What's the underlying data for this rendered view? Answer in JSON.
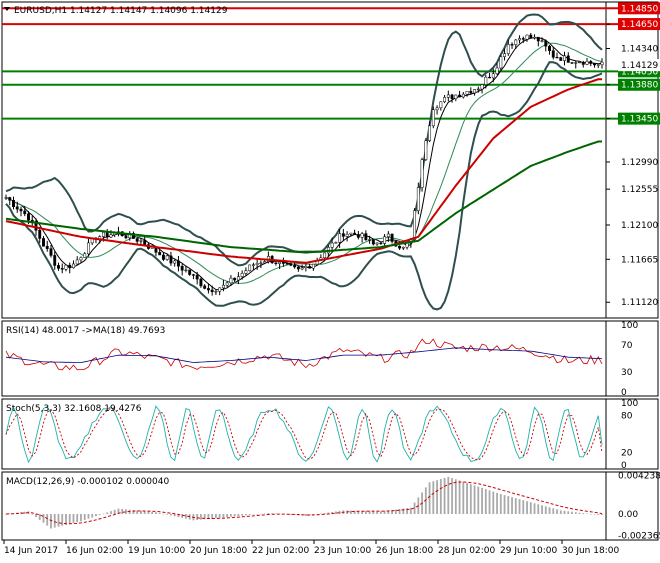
{
  "colors": {
    "candle": "#000000",
    "bb": "#2f4f4f",
    "ma_fast": "#000000",
    "ma_mid": "#2e8b57",
    "ma_red": "#cc0000",
    "ma_green": "#006400",
    "level_red": "#dd0000",
    "level_green": "#008000",
    "rsi_line": "#cc0000",
    "rsi_ma": "#000080",
    "stoch_main": "#20b2aa",
    "stoch_signal": "#cc0000",
    "macd_hist": "#a9a9a9",
    "macd_signal": "#cc0000"
  },
  "chart_data": [
    {
      "type": "candlestick",
      "title": "EURUSD,H1  1.14127 1.14147 1.14096 1.14129",
      "ylim": [
        1.1092,
        1.1493
      ],
      "y_ticks": [
        1.1112,
        1.11665,
        1.121,
        1.12555,
        1.129,
        1.1345,
        1.1388,
        1.1434,
        1.1465
      ],
      "y_tick_labels": [
        "1.11120",
        "1.11665",
        "1.12100",
        "1.12555",
        "1.12990",
        "1.13450",
        "1.13880",
        "1.14340",
        "1.14650"
      ],
      "levels": [
        {
          "value": 1.1485,
          "label": "1.14850",
          "color": "#dd0000"
        },
        {
          "value": 1.1465,
          "label": "1.14650",
          "color": "#dd0000"
        },
        {
          "value": 1.1405,
          "label": "1.14050",
          "color": "#008000"
        },
        {
          "value": 1.1388,
          "label": "1.13880",
          "color": "#008000"
        },
        {
          "value": 1.1345,
          "label": "1.13450",
          "color": "#008000"
        }
      ],
      "current_price": {
        "value": 1.14129,
        "label": "1.14129"
      },
      "price_keypoints": [
        [
          0,
          1.1245
        ],
        [
          6,
          1.122
        ],
        [
          10,
          1.1185
        ],
        [
          14,
          1.1155
        ],
        [
          18,
          1.116
        ],
        [
          24,
          1.1195
        ],
        [
          30,
          1.12
        ],
        [
          36,
          1.119
        ],
        [
          42,
          1.117
        ],
        [
          48,
          1.1152
        ],
        [
          54,
          1.1128
        ],
        [
          58,
          1.1132
        ],
        [
          62,
          1.1145
        ],
        [
          66,
          1.116
        ],
        [
          70,
          1.1168
        ],
        [
          74,
          1.1158
        ],
        [
          78,
          1.1152
        ],
        [
          82,
          1.1162
        ],
        [
          86,
          1.118
        ],
        [
          90,
          1.12
        ],
        [
          94,
          1.1198
        ],
        [
          98,
          1.1185
        ],
        [
          102,
          1.1195
        ],
        [
          106,
          1.118
        ],
        [
          108,
          1.119
        ],
        [
          110,
          1.126
        ],
        [
          112,
          1.132
        ],
        [
          114,
          1.136
        ],
        [
          118,
          1.1372
        ],
        [
          122,
          1.1378
        ],
        [
          126,
          1.1385
        ],
        [
          130,
          1.1405
        ],
        [
          134,
          1.144
        ],
        [
          138,
          1.145
        ],
        [
          142,
          1.1445
        ],
        [
          146,
          1.1425
        ],
        [
          150,
          1.142
        ],
        [
          154,
          1.1418
        ],
        [
          158,
          1.1413
        ]
      ],
      "ma_red_keypoints": [
        [
          0,
          1.1215
        ],
        [
          20,
          1.1195
        ],
        [
          40,
          1.1182
        ],
        [
          60,
          1.117
        ],
        [
          80,
          1.1162
        ],
        [
          100,
          1.118
        ],
        [
          110,
          1.1195
        ],
        [
          120,
          1.126
        ],
        [
          130,
          1.132
        ],
        [
          140,
          1.136
        ],
        [
          150,
          1.1382
        ],
        [
          158,
          1.1395
        ]
      ],
      "ma_green_keypoints": [
        [
          0,
          1.1218
        ],
        [
          20,
          1.1205
        ],
        [
          40,
          1.1195
        ],
        [
          60,
          1.1182
        ],
        [
          80,
          1.1175
        ],
        [
          100,
          1.1182
        ],
        [
          110,
          1.119
        ],
        [
          120,
          1.1225
        ],
        [
          130,
          1.1255
        ],
        [
          140,
          1.1285
        ],
        [
          150,
          1.1303
        ],
        [
          158,
          1.1316
        ]
      ]
    },
    {
      "type": "line",
      "title": "RSI(14) 48.0017  ->MA(18) 49.7693",
      "ylim": [
        0,
        100
      ],
      "y_ticks": [
        0,
        30,
        70,
        100
      ],
      "y_tick_labels": [
        "0",
        "30",
        "70",
        "100"
      ],
      "series": [
        {
          "name": "RSI(14)",
          "last": 48.0017,
          "keypoints": [
            [
              0,
              55
            ],
            [
              10,
              40
            ],
            [
              20,
              35
            ],
            [
              30,
              60
            ],
            [
              40,
              50
            ],
            [
              50,
              38
            ],
            [
              60,
              45
            ],
            [
              70,
              55
            ],
            [
              80,
              40
            ],
            [
              90,
              62
            ],
            [
              100,
              50
            ],
            [
              108,
              58
            ],
            [
              112,
              78
            ],
            [
              120,
              65
            ],
            [
              130,
              68
            ],
            [
              140,
              62
            ],
            [
              150,
              46
            ],
            [
              158,
              48
            ]
          ]
        },
        {
          "name": "MA(18)",
          "last": 49.7693,
          "keypoints": [
            [
              0,
              52
            ],
            [
              10,
              45
            ],
            [
              20,
              44
            ],
            [
              30,
              55
            ],
            [
              40,
              54
            ],
            [
              50,
              44
            ],
            [
              60,
              47
            ],
            [
              70,
              52
            ],
            [
              80,
              47
            ],
            [
              90,
              55
            ],
            [
              100,
              55
            ],
            [
              110,
              60
            ],
            [
              120,
              66
            ],
            [
              130,
              63
            ],
            [
              140,
              61
            ],
            [
              150,
              52
            ],
            [
              158,
              50
            ]
          ]
        }
      ]
    },
    {
      "type": "line",
      "title": "Stoch(5,3,3) 32.1608 19.4276",
      "ylim": [
        0,
        100
      ],
      "y_ticks": [
        0,
        20,
        80,
        100
      ],
      "y_tick_labels": [
        "0",
        "20",
        "80",
        "100"
      ],
      "series": [
        {
          "name": "Stoch main",
          "last": 32.1608
        },
        {
          "name": "Stoch signal",
          "last": 19.4276
        }
      ]
    },
    {
      "type": "bar",
      "title": "MACD(12,26,9) -0.000102 0.000040",
      "ylim": [
        -0.00265,
        0.00442
      ],
      "y_ticks": [
        0.004238,
        0.0,
        -0.002365
      ],
      "y_tick_labels": [
        "0.004238",
        "0.00",
        "-0.002365"
      ],
      "series": [
        {
          "name": "MACD",
          "last": -0.000102,
          "keypoints": [
            [
              0,
              0
            ],
            [
              6,
              0.0003
            ],
            [
              12,
              -0.0016
            ],
            [
              20,
              -0.0008
            ],
            [
              30,
              0.0006
            ],
            [
              40,
              0.0002
            ],
            [
              50,
              -0.0007
            ],
            [
              60,
              -0.0003
            ],
            [
              70,
              0.0001
            ],
            [
              80,
              -0.0002
            ],
            [
              90,
              0.0004
            ],
            [
              100,
              0.0003
            ],
            [
              108,
              0.0007
            ],
            [
              113,
              0.0035
            ],
            [
              118,
              0.0041
            ],
            [
              124,
              0.0033
            ],
            [
              132,
              0.0022
            ],
            [
              140,
              0.0013
            ],
            [
              148,
              0.0004
            ],
            [
              158,
              -0.0001
            ]
          ]
        },
        {
          "name": "Signal",
          "last": 4e-05
        }
      ]
    }
  ],
  "x_axis": {
    "labels": [
      "14 Jun 2017",
      "16 Jun 02:00",
      "19 Jun 10:00",
      "20 Jun 18:00",
      "22 Jun 02:00",
      "23 Jun 10:00",
      "26 Jun 18:00",
      "28 Jun 02:00",
      "29 Jun 10:00",
      "30 Jun 18:00"
    ]
  }
}
